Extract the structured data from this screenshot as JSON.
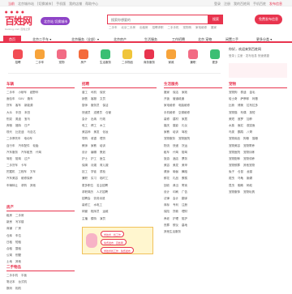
{
  "topbar": {
    "left": [
      "当前",
      "北京城市站",
      "[切换城市]",
      "手机版",
      "我的店铺",
      "帮助中心"
    ],
    "right": [
      "登录",
      "注册",
      "我的百姓网",
      "手机百姓",
      "发布信息"
    ]
  },
  "logo": {
    "mark": "百姓网",
    "dots": "● ● ● ●",
    "sub": "baixing.com 百姓之家"
  },
  "city_badge": "北京站 切换城市",
  "search": {
    "placeholder": "搜索你想要的",
    "button": "搜索"
  },
  "hotwords": [
    "二手车",
    "北京二手房",
    "出租房",
    "招聘求职",
    "二手手机",
    "宠物狗",
    "家电维修",
    "搬家"
  ],
  "post_button": "免费发布信息",
  "nav": [
    {
      "label": "首页",
      "active": true
    },
    {
      "label": "北京二手车 ▾"
    },
    {
      "label": "北京服务（全部）▾"
    },
    {
      "label": "北京房产"
    },
    {
      "label": "生活服务"
    },
    {
      "label": "工作招聘"
    },
    {
      "label": "北京 宠物"
    },
    {
      "label": "闲置二手"
    },
    {
      "label": "更多分类 ▾"
    }
  ],
  "categories": [
    {
      "label": "招聘",
      "color": "#f24d54"
    },
    {
      "label": "二手车",
      "color": "#f7a33a"
    },
    {
      "label": "宠物",
      "color": "#f26b84"
    },
    {
      "label": "房产",
      "color": "#f46b3b"
    },
    {
      "label": "生活服务",
      "color": "#3bbf73"
    },
    {
      "label": "二手物品",
      "color": "#f0c53a"
    },
    {
      "label": "商务服务",
      "color": "#e8344e"
    },
    {
      "label": "家政",
      "color": "#f7a33a"
    },
    {
      "label": "兼职",
      "color": "#f26b84"
    },
    {
      "label": "更多",
      "color": "#3bbf73"
    }
  ],
  "side": {
    "title": "你好，欢迎来到百姓网",
    "sub": "登录 | 注册 · 发布信息 快速便捷"
  },
  "columns": [
    {
      "title": "车辆",
      "lines": [
        [
          "二手车",
          "小轿车",
          "越野车"
        ],
        [
          "面包车",
          "SUV",
          "跑车"
        ],
        [
          "货车",
          "客车",
          "新能源"
        ],
        [
          "大众",
          "丰田",
          "本田"
        ],
        [
          "别克",
          "奥迪",
          "宝马"
        ],
        [
          "奔驰",
          "福特",
          "日产"
        ],
        [
          "现代",
          "比亚迪",
          "马自达"
        ],
        [
          "二手摩托车",
          "电动车"
        ],
        [
          "自行车",
          "汽车配件",
          "轮胎"
        ],
        [
          "汽车服务",
          "汽车租赁",
          "代驾"
        ],
        [
          "驾校",
          "陪驾",
          "过户"
        ],
        [
          "二手货车",
          "卡车"
        ],
        [
          "挖掘机",
          "工程车",
          "叉车"
        ],
        [
          "汽车美容",
          "维修保养"
        ],
        [
          "车辆转让",
          "求购",
          "其他"
        ]
      ]
    },
    {
      "title": "招聘",
      "lines": [
        [
          "普工",
          "司机",
          "保安"
        ],
        [
          "销售",
          "客服",
          "文员"
        ],
        [
          "厨师",
          "服务员",
          "保洁"
        ],
        [
          "快递员",
          "送餐员",
          "仓管"
        ],
        [
          "会计",
          "出纳",
          "行政"
        ],
        [
          "电工",
          "焊工",
          "木工"
        ],
        [
          "美容师",
          "美发",
          "化妆"
        ],
        [
          "导购",
          "收银",
          "理货"
        ],
        [
          "教师",
          "家教",
          "培训"
        ],
        [
          "设计",
          "编辑",
          "策划"
        ],
        [
          "护士",
          "护工",
          "医生"
        ],
        [
          "保姆",
          "月嫂",
          "育儿嫂"
        ],
        [
          "技工",
          "学徒",
          "质检"
        ],
        [
          "兼职",
          "实习",
          "临时工"
        ],
        [
          "更多职位",
          "名企招聘"
        ],
        [
          "求职简历",
          "人才招聘"
        ],
        [
          "招聘会",
          "劳务派遣"
        ],
        [
          "装修工",
          "水电工"
        ],
        [
          "网管",
          "程序员",
          "运维"
        ],
        [
          "主播",
          "模特",
          "演员"
        ]
      ]
    },
    {
      "title": "生活服务",
      "lines": [
        [
          "搬家",
          "保洁",
          "家政"
        ],
        [
          "开锁",
          "管道疏通"
        ],
        [
          "家电维修",
          "电脑维修"
        ],
        [
          "手机维修",
          "空调维修"
        ],
        [
          "装修",
          "建材",
          "家居"
        ],
        [
          "婚庆",
          "摄影",
          "礼仪"
        ],
        [
          "家教",
          "培训",
          "驾校"
        ],
        [
          "宠物服务",
          "宠物医院"
        ],
        [
          "物流",
          "快递",
          "货运"
        ],
        [
          "租车",
          "代驾",
          "陪驾"
        ],
        [
          "旅游",
          "酒店",
          "票务"
        ],
        [
          "美容",
          "美发",
          "美甲"
        ],
        [
          "健身",
          "瑜伽",
          "舞蹈"
        ],
        [
          "鲜花",
          "礼品",
          "蛋糕"
        ],
        [
          "回收",
          "典当",
          "寄卖"
        ],
        [
          "设计",
          "印刷",
          "广告"
        ],
        [
          "法律",
          "会计",
          "翻译"
        ],
        [
          "商标",
          "专利",
          "注册"
        ],
        [
          "保险",
          "贷款",
          "理财"
        ],
        [
          "养老",
          "护理",
          "陪护"
        ],
        [
          "丧葬",
          "殡仪",
          "墓地"
        ],
        [
          "其他生活服务"
        ]
      ]
    },
    {
      "title": "宠物",
      "lines": [
        [
          "宠物狗",
          "泰迪",
          "金毛"
        ],
        [
          "哈士奇",
          "萨摩耶",
          "柯基"
        ],
        [
          "比熊",
          "博美",
          "拉布拉多"
        ],
        [
          "宠物猫",
          "布偶",
          "英短"
        ],
        [
          "美短",
          "暹罗",
          "加菲"
        ],
        [
          "水族",
          "鱼缸",
          "观赏鱼"
        ],
        [
          "鸟类",
          "鹦鹉",
          "八哥"
        ],
        [
          "宠物用品",
          "狗粮",
          "猫粮"
        ],
        [
          "宠物美容",
          "宠物寄养"
        ],
        [
          "宠物医院",
          "宠物训练"
        ],
        [
          "宠物配种",
          "宠物领养"
        ],
        [
          "宠物殡葬",
          "其他宠物"
        ],
        [
          "兔子",
          "仓鼠",
          "龙猫"
        ],
        [
          "爬虫",
          "乌龟",
          "蜥蜴"
        ],
        [
          "昆虫",
          "蜘蛛",
          "蚂蚁"
        ],
        [
          "宠物服饰",
          "宠物玩具"
        ]
      ]
    }
  ],
  "section2": [
    {
      "title": "房产",
      "lines": [
        [
          "租房",
          "二手房"
        ],
        [
          "新房",
          "写字楼"
        ],
        [
          "商铺",
          "厂房"
        ],
        [
          "仓库",
          "车位"
        ],
        [
          "日租",
          "短租"
        ],
        [
          "合租",
          "整租"
        ],
        [
          "公寓",
          "别墅"
        ],
        [
          "土地",
          "其他"
        ]
      ]
    },
    {
      "title": "二手物品",
      "lines": [
        [
          "二手手机",
          "平板"
        ],
        [
          "笔记本",
          "台式机"
        ],
        [
          "数码",
          "相机"
        ],
        [
          "家电",
          "家具"
        ],
        [
          "服装",
          "箱包"
        ],
        [
          "母婴",
          "玩具"
        ],
        [
          "图书",
          "乐器"
        ],
        [
          "运动",
          "户外"
        ]
      ]
    }
  ],
  "ad": {
    "b1": "学技术 · 找工作",
    "b2": "免费发布 · 百姓网",
    "b3": "学技术找工作 · 免费发布"
  }
}
